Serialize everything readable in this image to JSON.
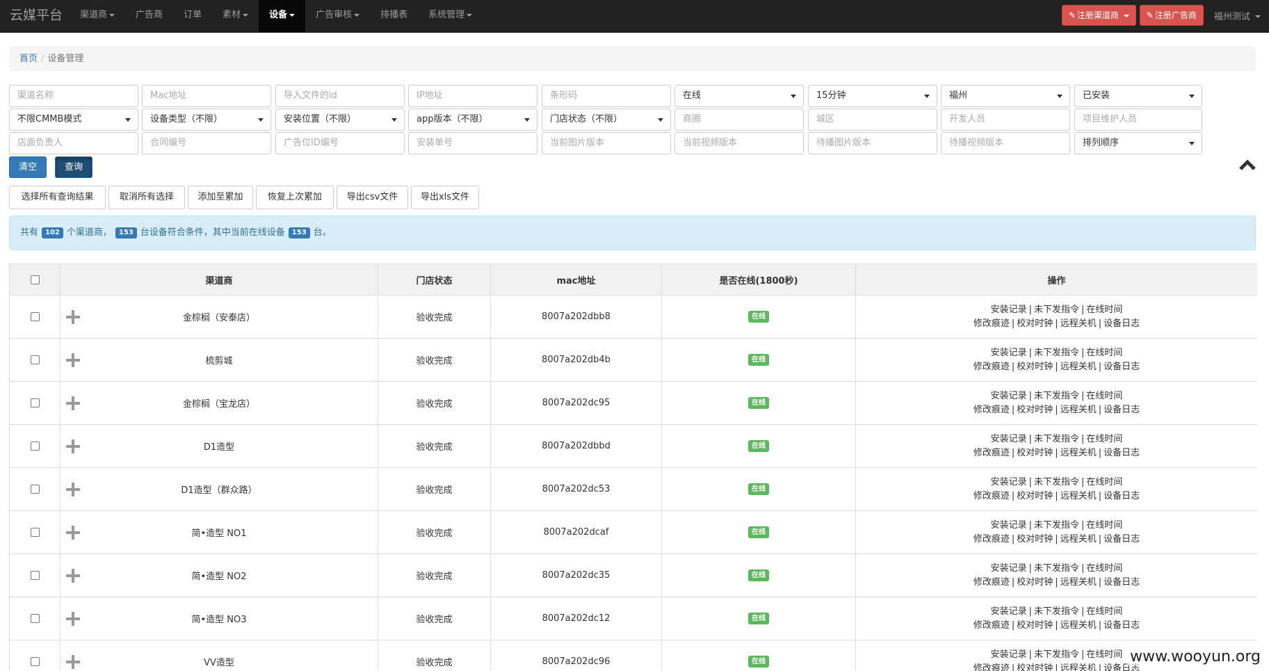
{
  "navbar": {
    "brand": "云媒平台",
    "items": [
      {
        "label": "渠道商",
        "dropdown": true,
        "active": false
      },
      {
        "label": "广告商",
        "dropdown": false,
        "active": false
      },
      {
        "label": "订单",
        "dropdown": false,
        "active": false
      },
      {
        "label": "素材",
        "dropdown": true,
        "active": false
      },
      {
        "label": "设备",
        "dropdown": true,
        "active": true
      },
      {
        "label": "广告审核",
        "dropdown": true,
        "active": false
      },
      {
        "label": "排播表",
        "dropdown": false,
        "active": false
      },
      {
        "label": "系统管理",
        "dropdown": true,
        "active": false
      }
    ],
    "register_channel": "注册渠道商",
    "register_advertiser": "注册广告商",
    "user": "福州测试"
  },
  "breadcrumb": {
    "home": "首页",
    "current": "设备管理"
  },
  "filters": {
    "row1": [
      {
        "type": "input",
        "placeholder": "渠道名称"
      },
      {
        "type": "input",
        "placeholder": "Mac地址"
      },
      {
        "type": "input",
        "placeholder": "导入文件的id"
      },
      {
        "type": "input",
        "placeholder": "IP地址"
      },
      {
        "type": "input",
        "placeholder": "条形码"
      },
      {
        "type": "select",
        "value": "在线"
      },
      {
        "type": "select",
        "value": "15分钟"
      },
      {
        "type": "select",
        "value": "福州"
      },
      {
        "type": "select",
        "value": "已安装"
      }
    ],
    "row2": [
      {
        "type": "select",
        "value": "不限CMMB模式"
      },
      {
        "type": "select",
        "value": "设备类型（不限）"
      },
      {
        "type": "select",
        "value": "安装位置（不限）"
      },
      {
        "type": "select",
        "value": "app版本（不限）"
      },
      {
        "type": "select",
        "value": "门店状态（不限）"
      },
      {
        "type": "input",
        "placeholder": "商圈"
      },
      {
        "type": "input",
        "placeholder": "城区"
      },
      {
        "type": "input",
        "placeholder": "开发人员"
      },
      {
        "type": "input",
        "placeholder": "项目维护人员"
      }
    ],
    "row3": [
      {
        "type": "input",
        "placeholder": "店面负责人"
      },
      {
        "type": "input",
        "placeholder": "合同编号"
      },
      {
        "type": "input",
        "placeholder": "广告位ID编号"
      },
      {
        "type": "input",
        "placeholder": "安装单号"
      },
      {
        "type": "input",
        "placeholder": "当前图片版本"
      },
      {
        "type": "input",
        "placeholder": "当前视频版本"
      },
      {
        "type": "input",
        "placeholder": "待播图片版本"
      },
      {
        "type": "input",
        "placeholder": "待播视频版本"
      },
      {
        "type": "select",
        "value": "排列顺序"
      }
    ]
  },
  "buttons": {
    "clear": "清空",
    "query": "查询"
  },
  "actions": [
    "选择所有查询结果",
    "取消所有选择",
    "添加至累加",
    "恢复上次累加",
    "导出csv文件",
    "导出xls文件"
  ],
  "summary": {
    "prefix": "共有",
    "channels": "102",
    "channel_text": "个渠道商，",
    "devices": "153",
    "device_text": "台设备符合条件，其中当前在线设备",
    "online": "153",
    "suffix": "台。"
  },
  "table": {
    "headers": {
      "channel": "渠道商",
      "store_status": "门店状态",
      "mac": "mac地址",
      "online": "是否在线(1800秒)",
      "ops": "操作"
    },
    "ops_line1": [
      "安装记录",
      "未下发指令",
      "在线时间"
    ],
    "ops_line2": [
      "修改痕迹",
      "校对时钟",
      "远程关机",
      "设备日志"
    ],
    "rows": [
      {
        "channel": "金棕榈（安泰店）",
        "store_status": "验收完成",
        "mac": "8007a202dbb8",
        "online": "在线"
      },
      {
        "channel": "梳剪城",
        "store_status": "验收完成",
        "mac": "8007a202db4b",
        "online": "在线"
      },
      {
        "channel": "金棕榈（宝龙店）",
        "store_status": "验收完成",
        "mac": "8007a202dc95",
        "online": "在线"
      },
      {
        "channel": "D1造型",
        "store_status": "验收完成",
        "mac": "8007a202dbbd",
        "online": "在线"
      },
      {
        "channel": "D1造型（群众路）",
        "store_status": "验收完成",
        "mac": "8007a202dc53",
        "online": "在线"
      },
      {
        "channel": "简•造型 NO1",
        "store_status": "验收完成",
        "mac": "8007a202dcaf",
        "online": "在线"
      },
      {
        "channel": "简•造型 NO2",
        "store_status": "验收完成",
        "mac": "8007a202dc35",
        "online": "在线"
      },
      {
        "channel": "简•造型 NO3",
        "store_status": "验收完成",
        "mac": "8007a202dc12",
        "online": "在线"
      },
      {
        "channel": "VV造型",
        "store_status": "验收完成",
        "mac": "8007a202dc96",
        "online": "在线"
      }
    ]
  },
  "watermark": "www.wooyun.org"
}
